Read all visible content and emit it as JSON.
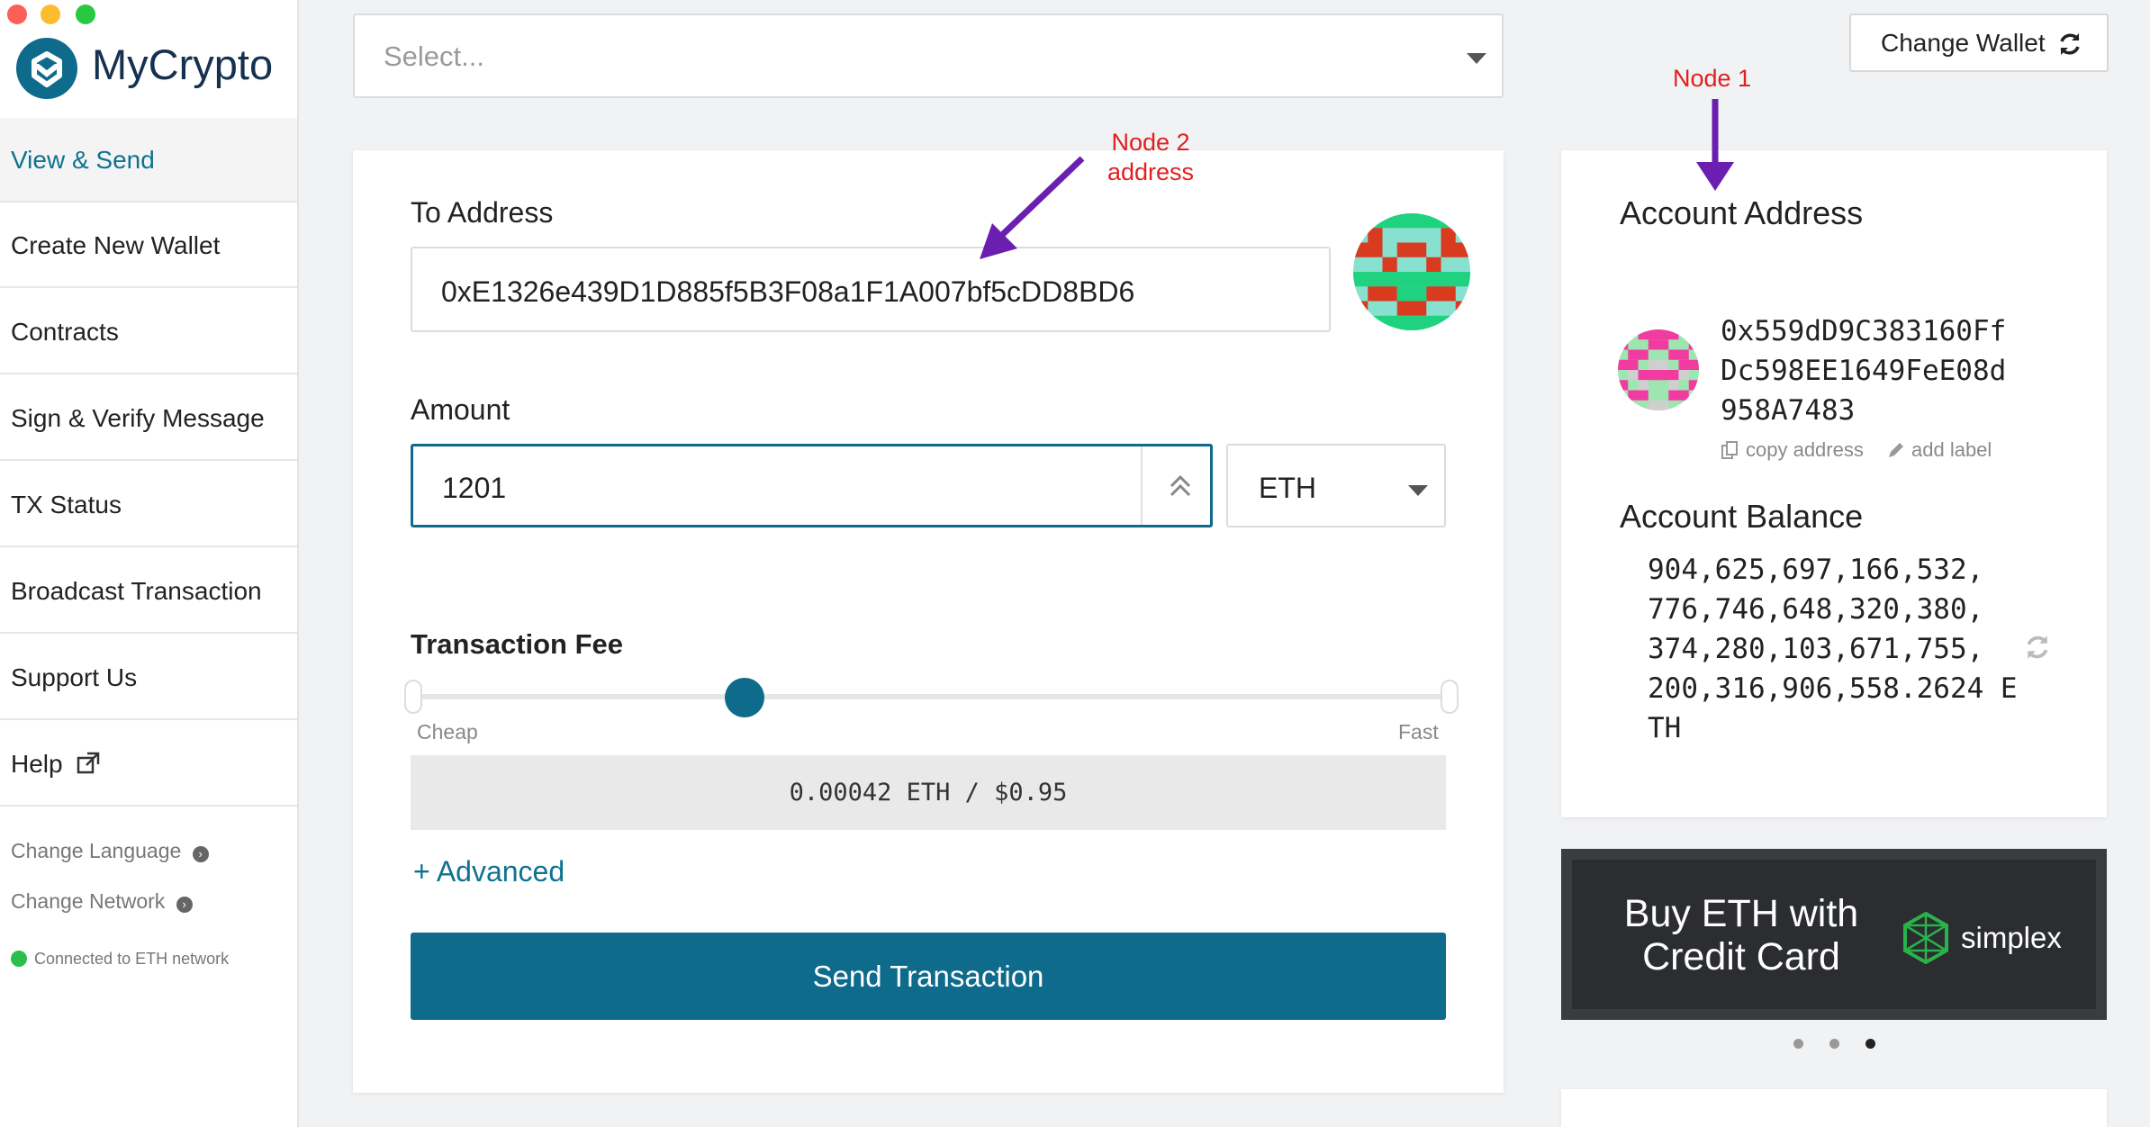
{
  "app": {
    "name": "MyCrypto"
  },
  "sidebar": {
    "items": [
      {
        "label": "View & Send"
      },
      {
        "label": "Create New Wallet"
      },
      {
        "label": "Contracts"
      },
      {
        "label": "Sign & Verify Message"
      },
      {
        "label": "TX Status"
      },
      {
        "label": "Broadcast Transaction"
      },
      {
        "label": "Support Us"
      },
      {
        "label": "Help"
      }
    ],
    "change_language": "Change Language",
    "change_network": "Change Network",
    "status": "Connected to ETH network"
  },
  "top": {
    "select_placeholder": "Select...",
    "change_wallet": "Change Wallet"
  },
  "form": {
    "to_address_label": "To Address",
    "to_address_value": "0xE1326e439D1D885f5B3F08a1F1A007bf5cDD8BD6",
    "amount_label": "Amount",
    "amount_value": "1201",
    "currency": "ETH",
    "fee_label": "Transaction Fee",
    "fee_cheap": "Cheap",
    "fee_fast": "Fast",
    "fee_level": 0.32,
    "fee_value": "0.00042 ETH / $0.95",
    "advanced": "+ Advanced",
    "send_button": "Send Transaction"
  },
  "account": {
    "address_title": "Account Address",
    "address_lines": [
      "0x559dD9C383160Ff",
      "Dc598EE1649FeE08d",
      "958A7483"
    ],
    "copy_address": "copy address",
    "add_label": "add label",
    "balance_title": "Account Balance",
    "balance_lines": [
      "904,625,697,166,532,",
      "776,746,648,320,380,",
      "374,280,103,671,755,",
      "200,316,906,558.2624 E",
      "TH"
    ]
  },
  "promo": {
    "line1": "Buy ETH with",
    "line2": "Credit Card",
    "brand": "simplex"
  },
  "annotations": {
    "node1": "Node 1",
    "node2_line1": "Node 2",
    "node2_line2": "address"
  },
  "colors": {
    "primary": "#0e6b8c",
    "annotation": "#e02020",
    "arrow": "#6a1fb0"
  }
}
